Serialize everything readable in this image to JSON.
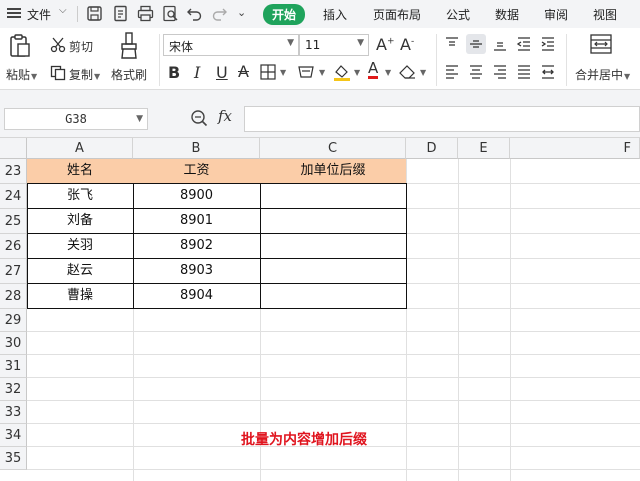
{
  "menubar": {
    "file_label": "文件",
    "tabs": [
      "开始",
      "插入",
      "页面布局",
      "公式",
      "数据",
      "审阅",
      "视图"
    ],
    "active_tab": "开始",
    "active_color": "#1fa35c"
  },
  "ribbon": {
    "paste_label": "粘贴",
    "cut_label": "剪切",
    "copy_label": "复制",
    "format_painter_label": "格式刷",
    "font_name": "宋体",
    "font_size": "11",
    "merge_center_label": "合并居中"
  },
  "formula_bar": {
    "cell_ref": "G38",
    "fx_label": "fx",
    "formula_value": ""
  },
  "sheet": {
    "columns": [
      "A",
      "B",
      "C",
      "D",
      "E",
      "F"
    ],
    "rows": [
      "23",
      "24",
      "25",
      "26",
      "27",
      "28",
      "29",
      "30",
      "31",
      "32",
      "33",
      "34",
      "35"
    ],
    "table": {
      "headers": [
        "姓名",
        "工资",
        "加单位后缀"
      ],
      "data": [
        [
          "张飞",
          "8900",
          ""
        ],
        [
          "刘备",
          "8901",
          ""
        ],
        [
          "关羽",
          "8902",
          ""
        ],
        [
          "赵云",
          "8903",
          ""
        ],
        [
          "曹操",
          "8904",
          ""
        ]
      ],
      "header_color": "#fbcda8"
    },
    "annotation": "批量为内容增加后缀",
    "annotation_color": "#e0141e"
  }
}
